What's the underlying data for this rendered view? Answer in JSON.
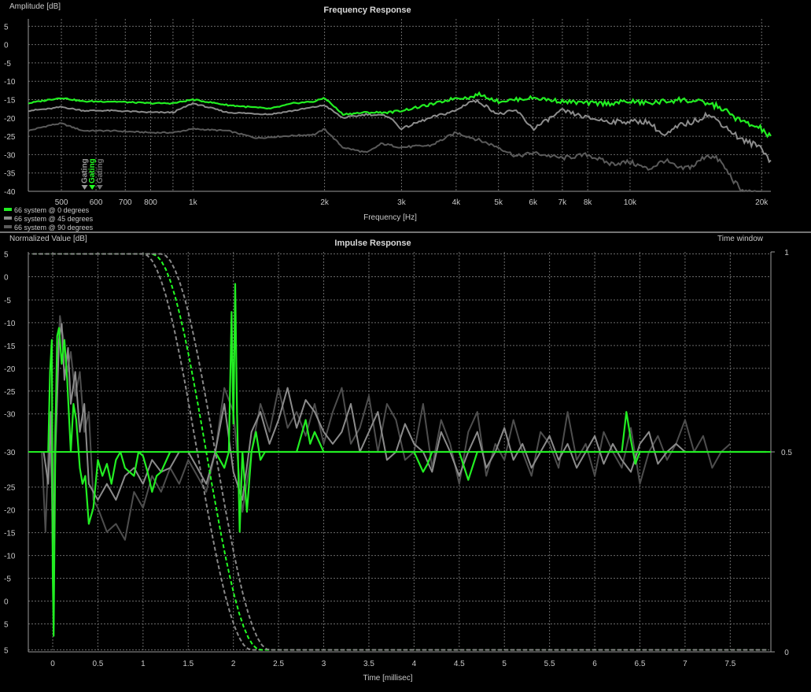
{
  "frequency_chart": {
    "title": "Frequency Response",
    "ylabel": "Amplitude [dB]",
    "xlabel": "Frequency [Hz]",
    "gating_labels": [
      "Gating",
      "Gating",
      "Gating"
    ],
    "legend": [
      "66 system @ 0 degrees",
      "66 system @ 45 degrees",
      "66 system @ 90 degrees"
    ]
  },
  "impulse_chart": {
    "title": "Impulse Response",
    "ylabel": "Normalized Value [dB]",
    "xlabel": "Time [millisec]",
    "right_label": "Time window"
  },
  "chart_data": [
    {
      "type": "line",
      "title": "Frequency Response",
      "xlabel": "Frequency [Hz]",
      "ylabel": "Amplitude [dB]",
      "xscale": "log",
      "xlim": [
        420,
        21000
      ],
      "ylim": [
        -40,
        7
      ],
      "grid": true,
      "legend_position": "bottom-left",
      "y_ticks": [
        5,
        0,
        -5,
        -10,
        -15,
        -20,
        -25,
        -30,
        -35,
        -40
      ],
      "y_tick_labels": [
        "5",
        "0",
        "-5",
        "-10",
        "-15",
        "-20",
        "-25",
        "-30",
        "-35",
        "-40"
      ],
      "x_ticks": [
        500,
        600,
        700,
        800,
        1000,
        2000,
        3000,
        4000,
        5000,
        6000,
        7000,
        8000,
        10000,
        20000
      ],
      "x_tick_labels": [
        "500",
        "600",
        "700",
        "800",
        "1k",
        "2k",
        "3k",
        "4k",
        "5k",
        "6k",
        "7k",
        "8k",
        "10k",
        "20k"
      ],
      "x_minor_grid": [
        900
      ],
      "gating_markers": [
        {
          "freq": 565,
          "color": "#9a9a9a"
        },
        {
          "freq": 588,
          "color": "#22ff22"
        },
        {
          "freq": 612,
          "color": "#707070"
        }
      ],
      "series": [
        {
          "name": "66 system @ 0 degrees",
          "color": "#22ee22",
          "x": [
            420,
            470,
            500,
            560,
            650,
            800,
            900,
            1000,
            1200,
            1500,
            1700,
            1900,
            2000,
            2200,
            2500,
            2800,
            3000,
            3300,
            3600,
            4000,
            4300,
            4500,
            5000,
            6000,
            7000,
            8000,
            9000,
            10000,
            11000,
            12000,
            13000,
            14000,
            15000,
            16000,
            18000,
            20000,
            21000
          ],
          "y": [
            -16,
            -15,
            -14.5,
            -15.5,
            -15.5,
            -16,
            -16,
            -15,
            -16.5,
            -17.5,
            -16,
            -15.5,
            -14.5,
            -19,
            -18.5,
            -18.5,
            -18,
            -17,
            -16,
            -14.5,
            -14.5,
            -13.5,
            -15.5,
            -14.5,
            -15.5,
            -16,
            -16,
            -15.5,
            -16,
            -15.5,
            -15,
            -15.5,
            -16,
            -17,
            -21,
            -23,
            -25.5
          ]
        },
        {
          "name": "66 system @ 45 degrees",
          "color": "#8c8c8c",
          "x": [
            420,
            470,
            500,
            560,
            650,
            800,
            900,
            1000,
            1200,
            1500,
            1700,
            1900,
            2000,
            2200,
            2500,
            2800,
            3000,
            3300,
            3600,
            4000,
            4300,
            4500,
            5000,
            5500,
            6000,
            7000,
            8000,
            9000,
            10000,
            11000,
            12000,
            13000,
            14000,
            15000,
            16000,
            18000,
            20000,
            21000
          ],
          "y": [
            -18,
            -17.5,
            -17,
            -18,
            -18,
            -18.5,
            -18.5,
            -16,
            -18.5,
            -19,
            -18,
            -17,
            -16.5,
            -20,
            -19,
            -19.5,
            -23,
            -21,
            -19.5,
            -18,
            -15.5,
            -15.5,
            -19,
            -18,
            -23,
            -18,
            -20,
            -21,
            -21,
            -21,
            -25,
            -22,
            -21,
            -19,
            -21,
            -26,
            -28,
            -32
          ]
        },
        {
          "name": "66 system @ 90 degrees",
          "color": "#5a5a5a",
          "x": [
            420,
            470,
            500,
            560,
            650,
            800,
            900,
            1000,
            1200,
            1400,
            1600,
            1900,
            2000,
            2200,
            2500,
            2700,
            3000,
            3500,
            4000,
            4500,
            5000,
            5500,
            6000,
            7000,
            8000,
            9000,
            10000,
            11000,
            12000,
            13000,
            14000,
            15000,
            16000,
            17000,
            18000,
            20000
          ],
          "y": [
            -23.5,
            -22,
            -21.5,
            -23.5,
            -23.5,
            -24,
            -24,
            -23,
            -23.5,
            -25.5,
            -25,
            -24.5,
            -23,
            -28,
            -29.5,
            -27,
            -28,
            -27.5,
            -24,
            -26,
            -28,
            -30.5,
            -29.5,
            -31,
            -30,
            -32.5,
            -32,
            -34,
            -31.5,
            -34,
            -33,
            -30,
            -31.5,
            -36,
            -40,
            -41
          ]
        }
      ]
    },
    {
      "type": "line",
      "title": "Impulse Response",
      "xlabel": "Time [millisec]",
      "ylabel": "Normalized Value [dB]",
      "y2label": "Time window",
      "xlim": [
        -0.27,
        7.95
      ],
      "ylim": [
        0,
        1
      ],
      "grid": true,
      "x_ticks": [
        0,
        0.5,
        1,
        1.5,
        2,
        2.5,
        3,
        3.5,
        4,
        4.5,
        5,
        5.5,
        6,
        6.5,
        7,
        7.5
      ],
      "x_tick_labels": [
        "0",
        "0.5",
        "1",
        "1.5",
        "2",
        "2.5",
        "3",
        "3.5",
        "4",
        "4.5",
        "5",
        "5.5",
        "6",
        "6.5",
        "7",
        "7.5"
      ],
      "y_ticks": [
        0.995,
        0.938,
        0.88,
        0.823,
        0.766,
        0.709,
        0.652,
        0.595,
        0.5,
        0.412,
        0.355,
        0.298,
        0.241,
        0.184,
        0.127,
        0.07,
        0.005
      ],
      "y_tick_labels": [
        "5",
        "0",
        "-5",
        "-10",
        "-15",
        "-20",
        "-25",
        "-30",
        "-30",
        "-25",
        "-20",
        "-15",
        "-10",
        "-5",
        "0",
        "5",
        "5"
      ],
      "y2_ticks": [
        1,
        0.5,
        0
      ],
      "y2_tick_labels": [
        "1",
        "0.5",
        "0"
      ],
      "baseline": 0.5,
      "time_windows": [
        {
          "name": "window-inner",
          "color": "#888888",
          "center": 1.6,
          "half_width": 0.6
        },
        {
          "name": "window-main",
          "color": "#22ff22",
          "center": 1.7,
          "half_width": 0.6
        },
        {
          "name": "window-outer",
          "color": "#888888",
          "center": 1.8,
          "half_width": 0.6
        }
      ],
      "series": [
        {
          "name": "impulse-0-degrees",
          "color": "#22ee22",
          "x": [
            -0.05,
            -0.03,
            -0.01,
            0,
            0.01,
            0.03,
            0.05,
            0.07,
            0.1,
            0.13,
            0.16,
            0.2,
            0.23,
            0.26,
            0.3,
            0.33,
            0.36,
            0.4,
            0.45,
            0.5,
            0.55,
            0.6,
            0.65,
            0.7,
            0.75,
            0.8,
            0.85,
            0.9,
            0.95,
            1.0,
            1.05,
            1.1,
            1.15,
            1.2,
            1.3,
            1.4,
            1.5,
            1.6,
            1.7,
            1.8,
            1.85,
            1.9,
            1.95,
            1.98,
            2.0,
            2.02,
            2.04,
            2.07,
            2.1,
            2.15,
            2.2,
            2.25,
            2.3,
            2.35,
            2.5,
            2.7,
            2.8,
            2.85,
            2.9,
            3.0,
            4.0,
            4.1,
            4.15,
            4.2,
            4.5,
            4.6,
            4.7,
            6.3,
            6.35,
            6.4,
            6.45,
            6.5,
            7.9
          ],
          "y": [
            0.5,
            0.7,
            0.78,
            0.2,
            0.04,
            0.55,
            0.79,
            0.81,
            0.72,
            0.78,
            0.68,
            0.5,
            0.62,
            0.58,
            0.46,
            0.42,
            0.44,
            0.32,
            0.36,
            0.48,
            0.44,
            0.47,
            0.42,
            0.48,
            0.5,
            0.46,
            0.45,
            0.44,
            0.5,
            0.49,
            0.45,
            0.4,
            0.44,
            0.45,
            0.5,
            0.5,
            0.5,
            0.5,
            0.5,
            0.5,
            0.48,
            0.46,
            0.5,
            0.85,
            0.57,
            0.92,
            0.6,
            0.3,
            0.5,
            0.35,
            0.5,
            0.55,
            0.48,
            0.5,
            0.5,
            0.5,
            0.58,
            0.52,
            0.55,
            0.5,
            0.5,
            0.45,
            0.47,
            0.5,
            0.5,
            0.43,
            0.5,
            0.5,
            0.6,
            0.53,
            0.47,
            0.5,
            0.5
          ]
        },
        {
          "name": "impulse-45-degrees",
          "color": "#8c8c8c",
          "x": [
            -0.1,
            -0.05,
            -0.02,
            0,
            0.03,
            0.07,
            0.1,
            0.13,
            0.17,
            0.2,
            0.25,
            0.3,
            0.35,
            0.4,
            0.5,
            0.6,
            0.7,
            0.8,
            0.9,
            1.0,
            1.1,
            1.2,
            1.3,
            1.4,
            1.5,
            1.6,
            1.7,
            1.8,
            1.9,
            2.0,
            2.1,
            2.2,
            2.3,
            2.4,
            2.5,
            2.6,
            2.7,
            2.8,
            2.9,
            3.0,
            3.1,
            3.2,
            3.3,
            3.4,
            3.5,
            3.6,
            3.7,
            3.8,
            3.9,
            4.0,
            4.1,
            4.2,
            4.3,
            4.4,
            4.5,
            4.6,
            4.7,
            4.8,
            4.9,
            5.0,
            5.1,
            5.2,
            5.3,
            5.4,
            5.5,
            5.6,
            5.7,
            5.8,
            5.9,
            6.0,
            6.1,
            6.2,
            6.3,
            6.4,
            6.5,
            6.6,
            6.7,
            6.8,
            6.9,
            7.0
          ],
          "y": [
            0.5,
            0.42,
            0.6,
            0.25,
            0.5,
            0.78,
            0.82,
            0.68,
            0.76,
            0.62,
            0.7,
            0.55,
            0.62,
            0.42,
            0.38,
            0.42,
            0.38,
            0.44,
            0.46,
            0.42,
            0.48,
            0.45,
            0.46,
            0.5,
            0.5,
            0.46,
            0.42,
            0.5,
            0.62,
            0.45,
            0.38,
            0.55,
            0.6,
            0.52,
            0.58,
            0.66,
            0.56,
            0.63,
            0.6,
            0.55,
            0.52,
            0.55,
            0.62,
            0.5,
            0.55,
            0.6,
            0.48,
            0.5,
            0.57,
            0.52,
            0.5,
            0.45,
            0.55,
            0.5,
            0.44,
            0.5,
            0.55,
            0.46,
            0.5,
            0.56,
            0.48,
            0.52,
            0.46,
            0.5,
            0.54,
            0.48,
            0.52,
            0.46,
            0.5,
            0.54,
            0.47,
            0.52,
            0.48,
            0.45,
            0.52,
            0.55,
            0.47,
            0.5,
            0.52,
            0.5
          ]
        },
        {
          "name": "impulse-90-degrees",
          "color": "#4e4e4e",
          "x": [
            -0.12,
            -0.08,
            -0.04,
            0,
            0.04,
            0.08,
            0.12,
            0.16,
            0.2,
            0.25,
            0.3,
            0.35,
            0.4,
            0.45,
            0.5,
            0.6,
            0.7,
            0.8,
            0.9,
            1.0,
            1.1,
            1.2,
            1.3,
            1.4,
            1.5,
            1.6,
            1.7,
            1.8,
            1.9,
            2.0,
            2.1,
            2.2,
            2.3,
            2.4,
            2.5,
            2.6,
            2.7,
            2.8,
            2.9,
            3.0,
            3.1,
            3.2,
            3.3,
            3.4,
            3.5,
            3.6,
            3.7,
            3.8,
            3.9,
            4.0,
            4.1,
            4.2,
            4.3,
            4.4,
            4.5,
            4.6,
            4.7,
            4.8,
            4.9,
            5.0,
            5.1,
            5.2,
            5.3,
            5.4,
            5.5,
            5.6,
            5.7,
            5.8,
            5.9,
            6.0,
            6.1,
            6.2,
            6.3,
            6.4,
            6.5,
            6.6,
            6.7,
            6.8,
            6.9,
            7.0,
            7.1,
            7.2,
            7.3,
            7.4,
            7.5
          ],
          "y": [
            0.5,
            0.3,
            0.55,
            0.38,
            0.65,
            0.84,
            0.78,
            0.7,
            0.75,
            0.64,
            0.7,
            0.55,
            0.6,
            0.38,
            0.36,
            0.3,
            0.32,
            0.28,
            0.4,
            0.36,
            0.44,
            0.4,
            0.46,
            0.42,
            0.48,
            0.44,
            0.4,
            0.5,
            0.66,
            0.6,
            0.35,
            0.5,
            0.62,
            0.55,
            0.66,
            0.56,
            0.6,
            0.54,
            0.62,
            0.52,
            0.6,
            0.66,
            0.52,
            0.56,
            0.64,
            0.5,
            0.62,
            0.58,
            0.48,
            0.5,
            0.62,
            0.46,
            0.58,
            0.52,
            0.42,
            0.55,
            0.6,
            0.44,
            0.52,
            0.48,
            0.58,
            0.5,
            0.44,
            0.55,
            0.52,
            0.46,
            0.6,
            0.48,
            0.52,
            0.44,
            0.55,
            0.5,
            0.46,
            0.56,
            0.42,
            0.5,
            0.54,
            0.48,
            0.52,
            0.58,
            0.5,
            0.54,
            0.46,
            0.5,
            0.52
          ]
        }
      ]
    }
  ]
}
